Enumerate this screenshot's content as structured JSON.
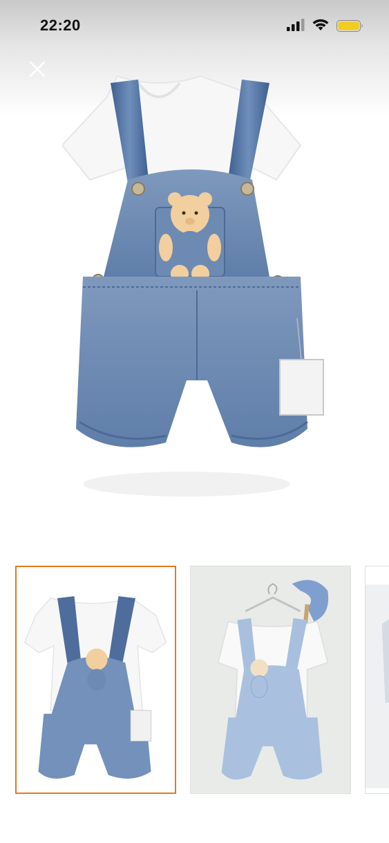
{
  "status_bar": {
    "time": "22:20",
    "icons": [
      "cellular-signal-icon",
      "wifi-icon",
      "battery-icon"
    ],
    "battery_color": "#f2cc1f"
  },
  "viewer": {
    "close_icon": "close-icon",
    "main_image": "baby-denim-overall-with-teddy-bear-photo",
    "thumbnails": [
      {
        "image": "denim-overall-white-background",
        "selected": true
      },
      {
        "image": "denim-overall-on-hanger",
        "selected": false
      },
      {
        "image": "partial-next-thumbnail",
        "selected": false
      }
    ],
    "accent_color": "#e07a1f"
  }
}
